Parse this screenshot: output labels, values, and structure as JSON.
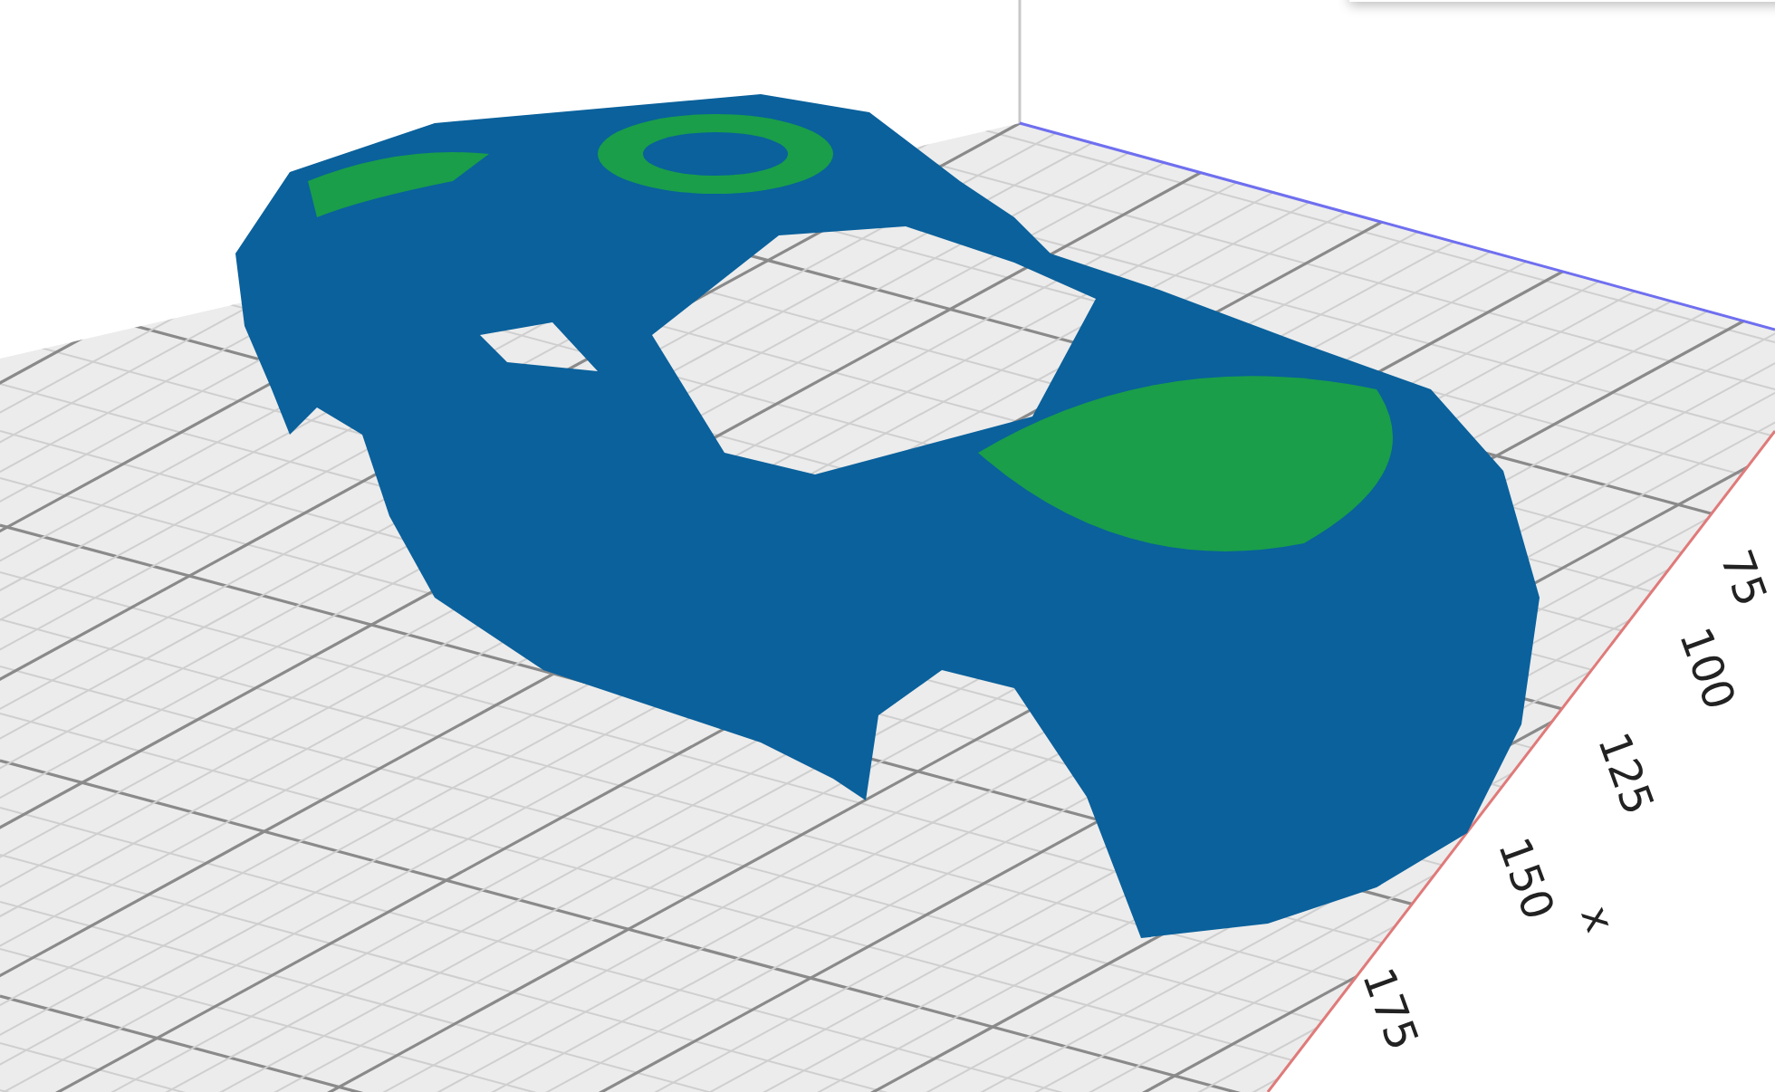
{
  "viewport": {
    "axis_labels": [
      {
        "kind": "tick",
        "text": "75"
      },
      {
        "kind": "tick",
        "text": "100"
      },
      {
        "kind": "tick",
        "text": "125"
      },
      {
        "kind": "tick",
        "text": "150"
      },
      {
        "kind": "axis",
        "text": "x"
      },
      {
        "kind": "tick",
        "text": "175"
      }
    ]
  }
}
